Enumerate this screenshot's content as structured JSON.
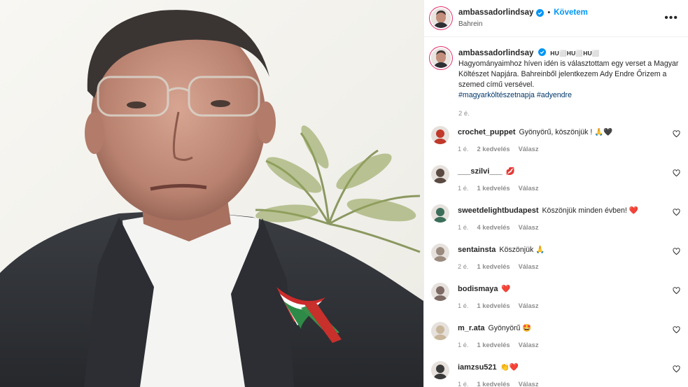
{
  "post": {
    "username": "ambassadorlindsay",
    "follow_label": "Követem",
    "location": "Bahrein",
    "more_label": "•••",
    "caption_flags": "HU⬜HU⬜HU⬜",
    "caption_text": "Hagyományaimhoz híven idén is választottam egy verset a Magyar Költészet Napjára. Bahreinből jelentkezem Ady Endre Őrizem a szemed című versével.",
    "hashtag_1": "#magyarköltészetnapja",
    "hashtag_2": "#adyendre",
    "caption_time": "2 é."
  },
  "comments": [
    {
      "username": "crochet_puppet",
      "text": "Gyönyörű, köszönjük ! 🙏🖤",
      "time": "1 é.",
      "likes": "2 kedvelés",
      "reply": "Válasz",
      "avatar_color": "#c0392b"
    },
    {
      "username": "___szilvi___",
      "text": "💋",
      "time": "1 é.",
      "likes": "1 kedvelés",
      "reply": "Válasz",
      "avatar_color": "#5a4a42"
    },
    {
      "username": "sweetdelightbudapest",
      "text": "Köszönjük minden évben! ❤️",
      "time": "1 é.",
      "likes": "4 kedvelés",
      "reply": "Válasz",
      "avatar_color": "#3b6e5a"
    },
    {
      "username": "sentainsta",
      "text": "Köszönjük 🙏",
      "time": "2 é.",
      "likes": "1 kedvelés",
      "reply": "Válasz",
      "avatar_color": "#9a8a7e"
    },
    {
      "username": "bodismaya",
      "text": "❤️",
      "time": "1 é.",
      "likes": "1 kedvelés",
      "reply": "Válasz",
      "avatar_color": "#7d6a64"
    },
    {
      "username": "m_r.ata",
      "text": "Gyönyörű 🤩",
      "time": "1 é.",
      "likes": "1 kedvelés",
      "reply": "Válasz",
      "avatar_color": "#c9b79c"
    },
    {
      "username": "iamzsu521",
      "text": "👏❤️",
      "time": "1 é.",
      "likes": "1 kedvelés",
      "reply": "Válasz",
      "avatar_color": "#3a3a3a"
    }
  ],
  "colors": {
    "accent": "#0095f6",
    "hashtag": "#00376b",
    "verified": "#0095f6",
    "muted": "#8e8e8e"
  }
}
